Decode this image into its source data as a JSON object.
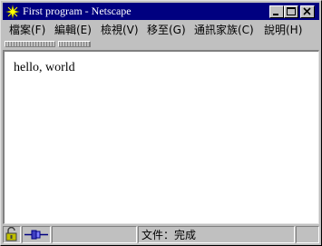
{
  "window": {
    "title": "First program - Netscape",
    "app_icon": "netscape-star-icon",
    "controls": [
      "minimize-icon",
      "maximize-icon",
      "close-icon"
    ]
  },
  "menubar": {
    "items": [
      {
        "label": "檔案(F)"
      },
      {
        "label": "編輯(E)"
      },
      {
        "label": "檢視(V)"
      },
      {
        "label": "移至(G)"
      },
      {
        "label": "通訊家族(C)"
      },
      {
        "label": "說明(H)"
      }
    ]
  },
  "page": {
    "text": "hello, world"
  },
  "statusbar": {
    "status_text": "文件：完成",
    "icons": [
      "security-lock-icon",
      "connection-status-icon"
    ]
  },
  "colors": {
    "titlebar": "#000080",
    "face": "#c0c0c0",
    "content": "#ffffff"
  }
}
